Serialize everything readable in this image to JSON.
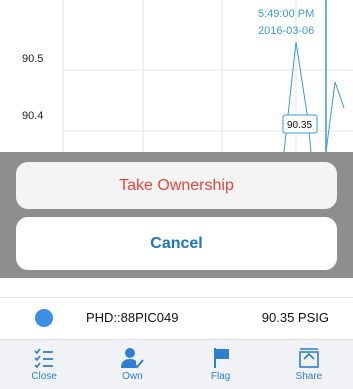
{
  "chart": {
    "timestamp_time": "5:49:00 PM",
    "timestamp_date": "2016-03-06",
    "y_tick_labels": [
      "90.5",
      "90.4"
    ],
    "tooltip_value": "90.35",
    "line_color": "#3a9ad9",
    "grid_color": "#e6e6e6"
  },
  "chart_data": {
    "type": "line",
    "title": "",
    "xlabel": "",
    "ylabel": "",
    "y_ticks": [
      90.5,
      90.4
    ],
    "series": [
      {
        "values": [
          90.35,
          90.52,
          90.35,
          90.38
        ]
      }
    ]
  },
  "action_sheet": {
    "take_ownership_label": "Take Ownership",
    "cancel_label": "Cancel",
    "take_ownership_color": "#e8453c",
    "cancel_color": "#1a73c9"
  },
  "tag_row": {
    "tag_name": "PHD::88PIC049",
    "tag_value": "90.35 PSIG",
    "dot_color": "#3a8ee6"
  },
  "tab_bar": {
    "accent": "#2f7fd1",
    "tabs": [
      {
        "label": "Close",
        "icon": "list-close-icon"
      },
      {
        "label": "Own",
        "icon": "person-check-icon"
      },
      {
        "label": "Flag",
        "icon": "flag-icon"
      },
      {
        "label": "Share",
        "icon": "share-icon"
      }
    ]
  }
}
